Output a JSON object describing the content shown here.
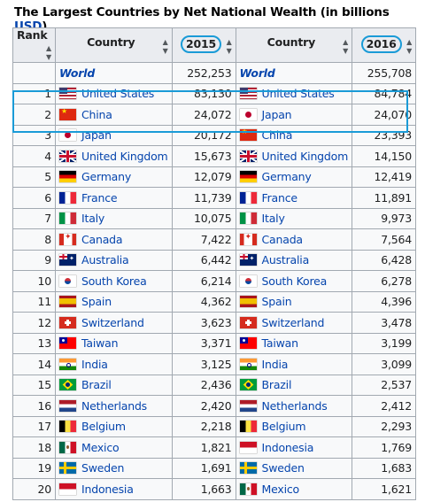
{
  "title": {
    "text": "The Largest Countries by Net National Wealth (in billions ",
    "link": "USD",
    "close": ")"
  },
  "headers": {
    "rank": "Rank",
    "country": "Country",
    "y2015": "2015",
    "y2016": "2016"
  },
  "rows": [
    {
      "rank": "",
      "c1": "World",
      "f1": "none",
      "v1": "252,253",
      "c2": "World",
      "f2": "none",
      "v2": "255,708"
    },
    {
      "rank": "1",
      "c1": "United States",
      "f1": "us",
      "v1": "83,130",
      "c2": "United States",
      "f2": "us",
      "v2": "84,784"
    },
    {
      "rank": "2",
      "c1": "China",
      "f1": "cn",
      "v1": "24,072",
      "c2": "Japan",
      "f2": "jp",
      "v2": "24,070"
    },
    {
      "rank": "3",
      "c1": "Japan",
      "f1": "jp",
      "v1": "20,172",
      "c2": "China",
      "f2": "cn",
      "v2": "23,393"
    },
    {
      "rank": "4",
      "c1": "United Kingdom",
      "f1": "uk",
      "v1": "15,673",
      "c2": "United Kingdom",
      "f2": "uk",
      "v2": "14,150"
    },
    {
      "rank": "5",
      "c1": "Germany",
      "f1": "de",
      "v1": "12,079",
      "c2": "Germany",
      "f2": "de",
      "v2": "12,419"
    },
    {
      "rank": "6",
      "c1": "France",
      "f1": "fr",
      "v1": "11,739",
      "c2": "France",
      "f2": "fr",
      "v2": "11,891"
    },
    {
      "rank": "7",
      "c1": "Italy",
      "f1": "it",
      "v1": "10,075",
      "c2": "Italy",
      "f2": "it",
      "v2": "9,973"
    },
    {
      "rank": "8",
      "c1": "Canada",
      "f1": "ca",
      "v1": "7,422",
      "c2": "Canada",
      "f2": "ca",
      "v2": "7,564"
    },
    {
      "rank": "9",
      "c1": "Australia",
      "f1": "au",
      "v1": "6,442",
      "c2": "Australia",
      "f2": "au",
      "v2": "6,428"
    },
    {
      "rank": "10",
      "c1": "South Korea",
      "f1": "kr",
      "v1": "6,214",
      "c2": "South Korea",
      "f2": "kr",
      "v2": "6,278"
    },
    {
      "rank": "11",
      "c1": "Spain",
      "f1": "es",
      "v1": "4,362",
      "c2": "Spain",
      "f2": "es",
      "v2": "4,396"
    },
    {
      "rank": "12",
      "c1": "Switzerland",
      "f1": "ch",
      "v1": "3,623",
      "c2": "Switzerland",
      "f2": "ch",
      "v2": "3,478"
    },
    {
      "rank": "13",
      "c1": "Taiwan",
      "f1": "tw",
      "v1": "3,371",
      "c2": "Taiwan",
      "f2": "tw",
      "v2": "3,199"
    },
    {
      "rank": "14",
      "c1": "India",
      "f1": "in",
      "v1": "3,125",
      "c2": "India",
      "f2": "in",
      "v2": "3,099"
    },
    {
      "rank": "15",
      "c1": "Brazil",
      "f1": "br",
      "v1": "2,436",
      "c2": "Brazil",
      "f2": "br",
      "v2": "2,537"
    },
    {
      "rank": "16",
      "c1": "Netherlands",
      "f1": "nl",
      "v1": "2,420",
      "c2": "Netherlands",
      "f2": "nl",
      "v2": "2,412"
    },
    {
      "rank": "17",
      "c1": "Belgium",
      "f1": "be",
      "v1": "2,218",
      "c2": "Belgium",
      "f2": "be",
      "v2": "2,293"
    },
    {
      "rank": "18",
      "c1": "Mexico",
      "f1": "mx",
      "v1": "1,821",
      "c2": "Indonesia",
      "f2": "id",
      "v2": "1,769"
    },
    {
      "rank": "19",
      "c1": "Sweden",
      "f1": "se",
      "v1": "1,691",
      "c2": "Sweden",
      "f2": "se",
      "v2": "1,683"
    },
    {
      "rank": "20",
      "c1": "Indonesia",
      "f1": "id",
      "v1": "1,663",
      "c2": "Mexico",
      "f2": "mx",
      "v2": "1,621"
    }
  ],
  "colors": {
    "header_bg": "#eaecf0",
    "cell_bg": "#f8f9fa",
    "border": "#a2a9b1",
    "link": "#0645ad",
    "highlight": "#1a9bd7"
  }
}
